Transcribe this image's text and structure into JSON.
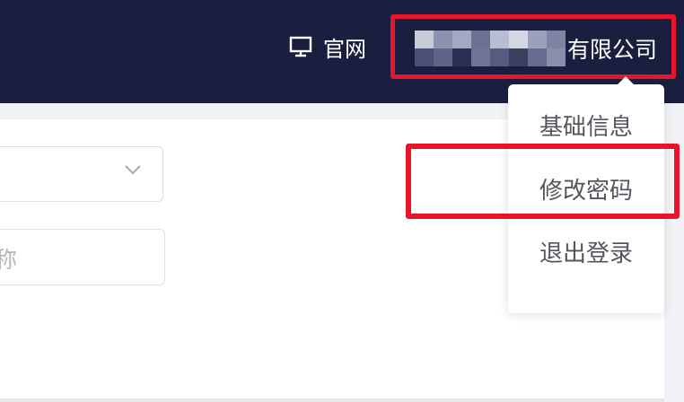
{
  "header": {
    "website_label": "官网",
    "company_suffix": "有限公司"
  },
  "form": {
    "name_field_hint": "昵称"
  },
  "user_menu": {
    "items": [
      {
        "label": "基础信息"
      },
      {
        "label": "修改密码"
      },
      {
        "label": "退出登录"
      }
    ]
  },
  "colors": {
    "header_bg": "#1b1f3f",
    "highlight": "#e8152a"
  },
  "icons": {
    "website": "monitor-icon",
    "select": "chevron-down-icon"
  }
}
